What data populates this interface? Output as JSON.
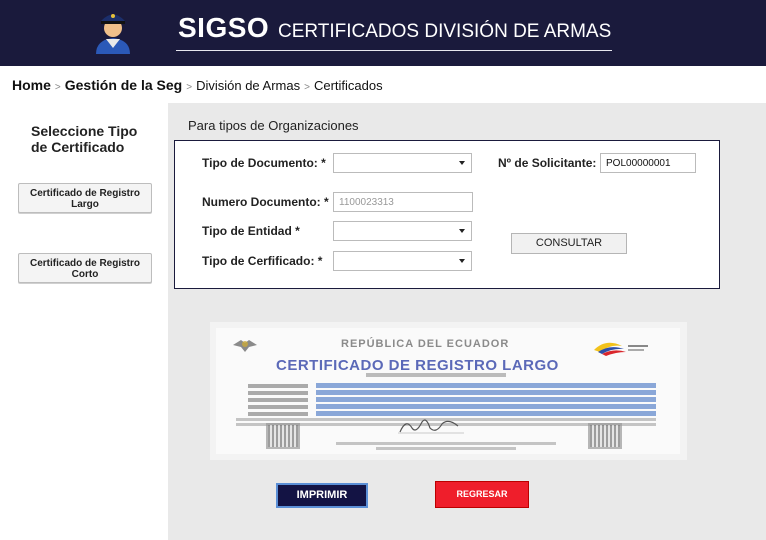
{
  "header": {
    "brand": "SIGSO",
    "subtitle": "CERTIFICADOS DIVISIÓN DE ARMAS",
    "avatar_icon": "police-officer-icon"
  },
  "breadcrumb": [
    "Home",
    "Gestión de la Seg",
    "División de Armas",
    "Certificados"
  ],
  "sidebar": {
    "title": "Seleccione Tipo de Certificado",
    "buttons": [
      "Certificado de Registro Largo",
      "Certificado de Registro Corto"
    ]
  },
  "form": {
    "section_title": "Para tipos de Organizaciones",
    "tipo_documento_label": "Tipo de Documento: *",
    "tipo_documento_value": "",
    "numero_documento_label": "Numero Documento: *",
    "numero_documento_placeholder": "1100023313",
    "tipo_entidad_label": "Tipo de Entidad *",
    "tipo_entidad_value": "",
    "tipo_certificado_label": "Tipo de Cerfificado: *",
    "tipo_certificado_value": "",
    "solicitante_label": "Nº de Solicitante:",
    "solicitante_value": "POL00000001",
    "consultar_label": "CONSULTAR"
  },
  "certificate_preview": {
    "country": "REPÚBLICA DEL ECUADOR",
    "title": "CERTIFICADO DE REGISTRO LARGO"
  },
  "actions": {
    "print_label": "IMPRIMIR",
    "back_label": "REGRESAR"
  },
  "colors": {
    "header_bg": "#1a1a3c",
    "main_bg": "#e9e9e9",
    "print_bg": "#131344",
    "back_bg": "#ef1e2b"
  }
}
